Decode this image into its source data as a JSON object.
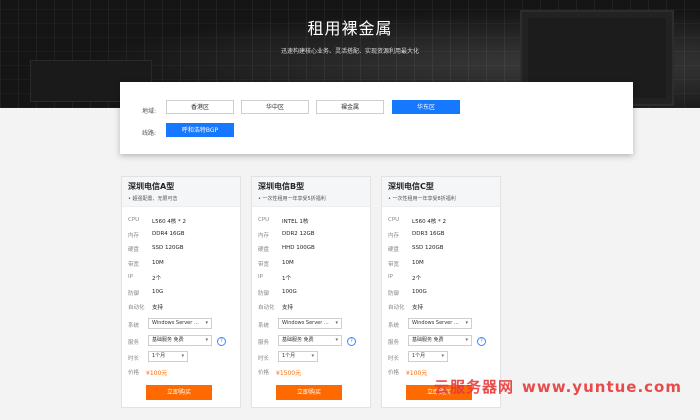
{
  "hero": {
    "title": "租用裸金属",
    "subtitle": "迅速构建核心业务、灵活搭配、实现资源利用最大化"
  },
  "filter": {
    "region_label": "地域:",
    "regions": [
      "香港区",
      "华中区",
      "裸金属",
      "华东区"
    ],
    "active_region": "华东区",
    "line_label": "线路:",
    "line_option": "呼和浩特BGP"
  },
  "spec_labels": {
    "cpu": "CPU",
    "memory": "内存",
    "disk": "硬盘",
    "bandwidth": "带宽",
    "ip": "IP",
    "defense": "防御",
    "auto": "自动化",
    "os": "系统",
    "service": "服务",
    "duration": "时长",
    "price": "价格"
  },
  "cards": [
    {
      "title": "深圳电信A型",
      "subtitle": "• 超强配置、无限可击",
      "cpu": "L560 4核 * 2",
      "memory": "DDR4 16GB",
      "disk": "SSD 120GB",
      "bandwidth": "10M",
      "ip": "2个",
      "defense": "10G",
      "auto": "支持",
      "os": "Windows Server ...",
      "service": "基础服务 免费",
      "duration": "1个月",
      "price": "¥100元",
      "buy_label": "立即购买"
    },
    {
      "title": "深圳电信B型",
      "subtitle": "• 一次性租用一年享受5折福利",
      "cpu": "INTEL 1核",
      "memory": "DDR2 12GB",
      "disk": "HHD 100GB",
      "bandwidth": "10M",
      "ip": "1个",
      "defense": "100G",
      "auto": "支持",
      "os": "Windows Server ...",
      "service": "基础服务 免费",
      "duration": "1个月",
      "price": "¥1500元",
      "buy_label": "立即购买"
    },
    {
      "title": "深圳电信C型",
      "subtitle": "• 一次性租用一年享受8折福利",
      "cpu": "L560 4核 * 2",
      "memory": "DDR3 16GB",
      "disk": "SSD 120GB",
      "bandwidth": "10M",
      "ip": "2个",
      "defense": "100G",
      "auto": "支持",
      "os": "Windows Server ...",
      "service": "基础服务 免费",
      "duration": "1个月",
      "price": "¥100元",
      "buy_label": "立即购买"
    }
  ],
  "watermark": {
    "cn": "云服务器网",
    "url": "www.yuntue.com"
  },
  "colors": {
    "accent_blue": "#1677ff",
    "buy_orange": "#ff6a00",
    "price_orange": "#ff6a00",
    "watermark_red": "#e63a3a"
  }
}
